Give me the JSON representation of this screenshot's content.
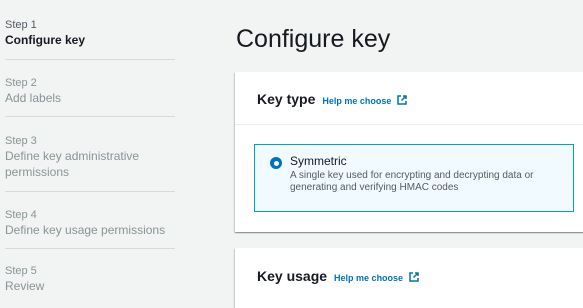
{
  "steps": [
    {
      "num": "Step 1",
      "name": "Configure key",
      "active": true
    },
    {
      "num": "Step 2",
      "name": "Add labels"
    },
    {
      "num": "Step 3",
      "name": "Define key administrative permissions"
    },
    {
      "num": "Step 4",
      "name": "Define key usage permissions"
    },
    {
      "num": "Step 5",
      "name": "Review"
    }
  ],
  "page_title": "Configure key",
  "key_type": {
    "heading": "Key type",
    "help": "Help me choose",
    "option": {
      "label": "Symmetric",
      "description": "A single key used for encrypting and decrypting data or generating and verifying HMAC codes",
      "selected": true
    }
  },
  "key_usage": {
    "heading": "Key usage",
    "help": "Help me choose"
  },
  "colors": {
    "link": "#0073bb",
    "accent_border": "#00a1c9",
    "selected_bg": "#f1faff"
  },
  "icons": {
    "help_link": "external-link-icon",
    "option": "radio-selected-icon"
  }
}
